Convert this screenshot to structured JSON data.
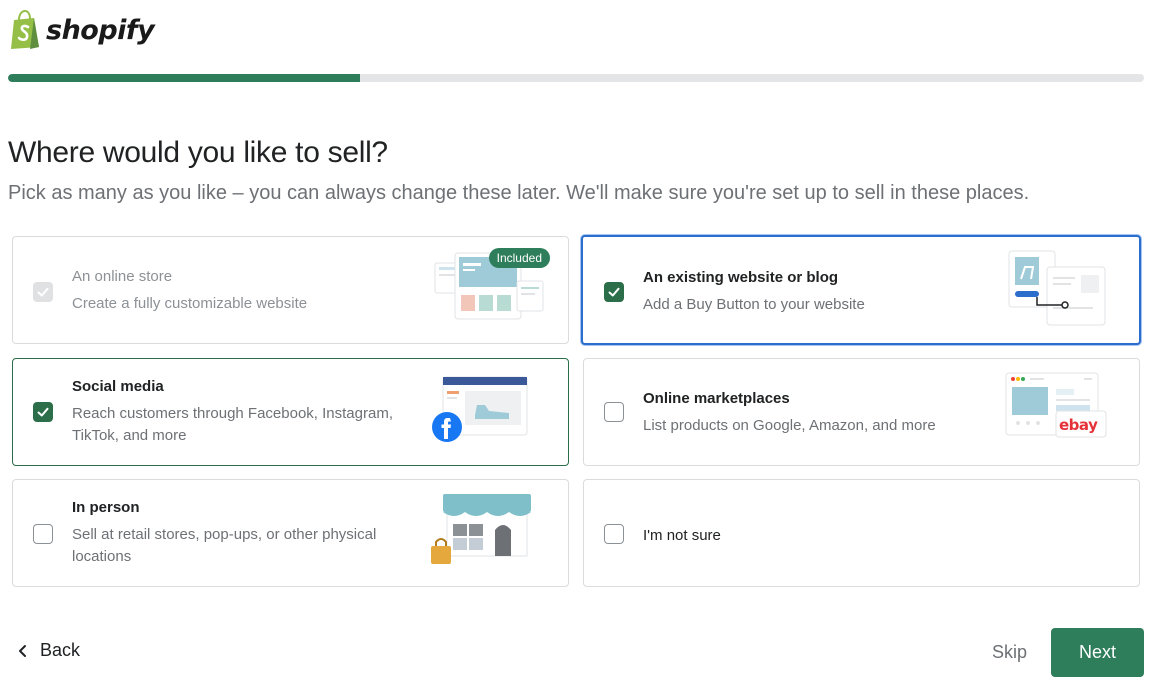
{
  "brand": {
    "name": "shopify",
    "logo_icon": "shopify-bag-icon",
    "accent": "#2e7d5b"
  },
  "progress": {
    "fraction": 0.31
  },
  "header": {
    "title": "Where would you like to sell?",
    "subtitle": "Pick as many as you like – you can always change these later. We'll make sure you're set up to sell in these places."
  },
  "options": [
    {
      "id": "online_store",
      "title": "An online store",
      "description": "Create a fully customizable website",
      "checked": true,
      "disabled": true,
      "badge": "Included"
    },
    {
      "id": "existing_website",
      "title": "An existing website or blog",
      "description": "Add a Buy Button to your website",
      "checked": true,
      "disabled": false
    },
    {
      "id": "social_media",
      "title": "Social media",
      "description": "Reach customers through Facebook, Instagram, TikTok, and more",
      "checked": true,
      "disabled": false
    },
    {
      "id": "marketplaces",
      "title": "Online marketplaces",
      "description": "List products on Google, Amazon, and more",
      "checked": false,
      "disabled": false,
      "marketplace_label": "ebay"
    },
    {
      "id": "in_person",
      "title": "In person",
      "description": "Sell at retail stores, pop-ups, or other physical locations",
      "checked": false,
      "disabled": false
    },
    {
      "id": "not_sure",
      "title": "I'm not sure",
      "checked": false,
      "disabled": false
    }
  ],
  "footer": {
    "back_label": "Back",
    "skip_label": "Skip",
    "next_label": "Next"
  }
}
